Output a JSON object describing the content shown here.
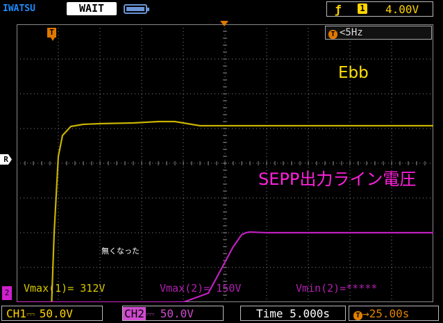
{
  "header": {
    "brand": "IWATSU",
    "status": "WAIT",
    "trigger_edge_icon": "rising-edge-icon",
    "trigger_source": "1",
    "trigger_level": "4.00V"
  },
  "screen": {
    "frequency_readout": "<5Hz",
    "trigger_marker": "T",
    "ref_marker": "R",
    "ch2_marker": "2"
  },
  "annotations": {
    "ebb_label": "Ebb",
    "sepp_label": "SEPP出力ライン電圧",
    "note": "無くなった"
  },
  "measurements": {
    "vmax1": "Vmax(1)= 312V",
    "vmax2": "Vmax(2)= 150V",
    "vmin2": "Vmin(2)=*****"
  },
  "footer": {
    "ch1_label": "CH1",
    "ch1_coupling": "⎓",
    "ch1_scale": "50.0V",
    "ch2_label": "CH2",
    "ch2_coupling": "⎓",
    "ch2_scale": "50.0V",
    "time_label": "Time 5.000s",
    "trigger_offset": "→25.00s"
  },
  "colors": {
    "ch1": "#c8b400",
    "ch2": "#c020c0",
    "trigger": "#e07800",
    "grid": "#8a8a8a"
  },
  "chart_data": {
    "type": "line",
    "xlabel": "",
    "ylabel": "",
    "grid": true,
    "xlim": [
      0,
      50
    ],
    "x_unit": "s",
    "time_per_div": 5,
    "volts_per_div": 50,
    "ylim": [
      -150,
      250
    ],
    "series": [
      {
        "name": "Ebb",
        "x": [
          0,
          4.2,
          4.5,
          5.0,
          5.5,
          6.5,
          8,
          10,
          14,
          17,
          19,
          21,
          22,
          25,
          30,
          40,
          50
        ],
        "y": [
          -150,
          -150,
          -50,
          60,
          90,
          103,
          106,
          107,
          108,
          110,
          110,
          106,
          104,
          104,
          104,
          104,
          104
        ]
      },
      {
        "name": "SEPP出力ライン電圧",
        "x": [
          0,
          20,
          23,
          26,
          27,
          27.5,
          28,
          30,
          35,
          40,
          50
        ],
        "y": [
          -150,
          -150,
          -137,
          -70,
          -53,
          -50,
          -49,
          -50,
          -50,
          -50,
          -50
        ]
      }
    ]
  }
}
